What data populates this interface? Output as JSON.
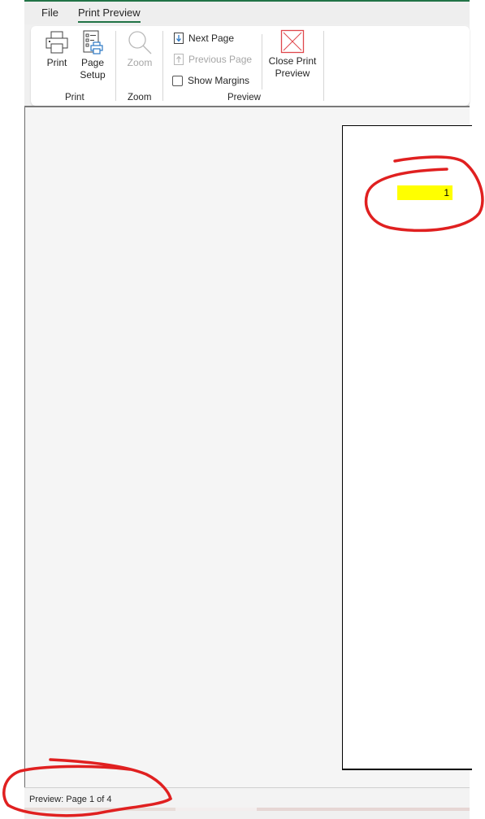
{
  "tabs": {
    "file": "File",
    "print_preview": "Print Preview"
  },
  "ribbon": {
    "groups": {
      "print": {
        "label": "Print",
        "print_button": "Print",
        "page_setup_line1": "Page",
        "page_setup_line2": "Setup"
      },
      "zoom": {
        "label": "Zoom",
        "zoom_button": "Zoom"
      },
      "preview": {
        "label": "Preview",
        "next_page": "Next Page",
        "previous_page": "Previous Page",
        "show_margins": "Show Margins",
        "show_margins_checked": false,
        "close_line1": "Close Print",
        "close_line2": "Preview"
      }
    }
  },
  "preview": {
    "cell_value": "1",
    "cell_highlight_color": "#ffff00"
  },
  "status": {
    "text": "Preview: Page 1 of 4"
  },
  "colors": {
    "accent": "#217346",
    "annotation": "#e02020",
    "close_icon": "#e0474c",
    "next_page_arrow": "#2b78c5"
  }
}
